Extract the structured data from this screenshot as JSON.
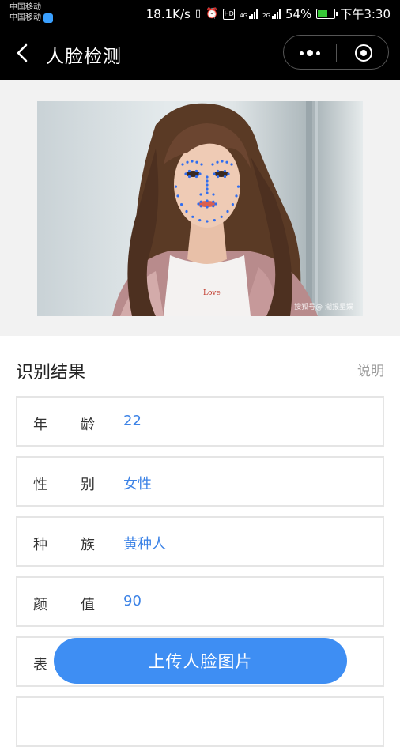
{
  "status_bar": {
    "carrier_1": "中国移动",
    "carrier_2": "中国移动",
    "speed": "18.1K/s",
    "network_1": "4G",
    "network_2": "2G",
    "battery": "54%",
    "battery_level": 0.54,
    "time": "下午3:30",
    "hd": "HD"
  },
  "nav": {
    "title": "人脸检测"
  },
  "photo": {
    "watermark": "搜狐号@ 潮报星娱"
  },
  "results": {
    "title": "识别结果",
    "help": "说明",
    "rows": [
      {
        "label_a": "年",
        "label_b": "龄",
        "value": "22"
      },
      {
        "label_a": "性",
        "label_b": "别",
        "value": "女性"
      },
      {
        "label_a": "种",
        "label_b": "族",
        "value": "黄种人"
      },
      {
        "label_a": "颜",
        "label_b": "值",
        "value": "90"
      },
      {
        "label_a": "表",
        "label_b": "",
        "value": ""
      }
    ]
  },
  "upload_button": "上传人脸图片",
  "colors": {
    "accent": "#3e8ef3",
    "value_text": "#3d83e6",
    "nav_bg": "#000000",
    "landmark": "#2f6df0"
  },
  "icons": [
    "back-arrow-icon",
    "more-dots-icon",
    "target-icon",
    "signal-icon",
    "battery-icon",
    "alarm-icon",
    "vibrate-icon"
  ]
}
